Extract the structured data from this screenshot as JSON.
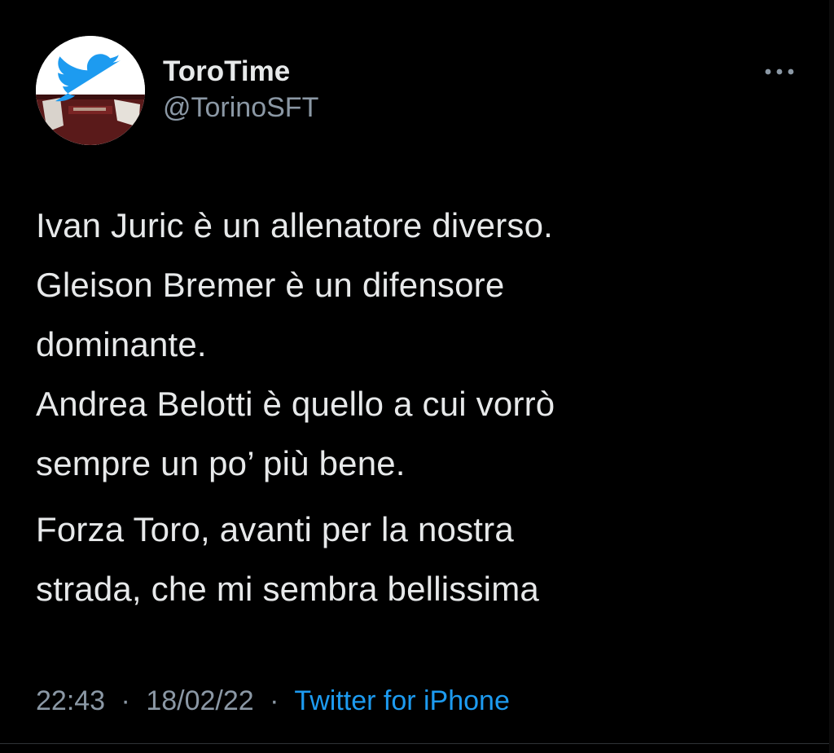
{
  "author": {
    "display_name": "ToroTime",
    "handle": "@TorinoSFT",
    "avatar_icon": "twitter-bird-icon"
  },
  "more_icon": "more-options-icon",
  "tweet": {
    "paragraphs": [
      [
        "Ivan Juric è un allenatore diverso.",
        "Gleison Bremer è un difensore",
        "dominante.",
        "Andrea Belotti è quello a cui vorrò",
        "sempre un po’ più bene."
      ],
      [
        "Forza Toro, avanti per la nostra",
        "strada, che mi sembra bellissima"
      ]
    ]
  },
  "meta": {
    "time": "22:43",
    "separator": "·",
    "date": "18/02/22",
    "source": "Twitter for iPhone"
  },
  "colors": {
    "background": "#000000",
    "text": "#e7e9ea",
    "muted": "#8b98a5",
    "link": "#1d9bf0",
    "bird": "#1d9bf0",
    "jersey": "#6b1d1d"
  }
}
